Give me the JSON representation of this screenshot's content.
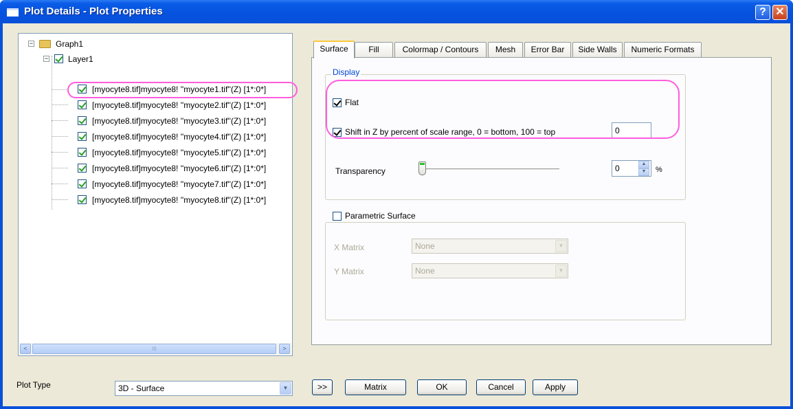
{
  "window": {
    "title": "Plot Details - Plot Properties",
    "help_glyph": "?",
    "close_glyph": "✕"
  },
  "tree": {
    "root_label": "Graph1",
    "layer_label": "Layer1",
    "items": [
      "[myocyte8.tif]myocyte8! ''myocyte1.tif''(Z) [1*:0*]",
      "[myocyte8.tif]myocyte8! ''myocyte2.tif''(Z) [1*:0*]",
      "[myocyte8.tif]myocyte8! ''myocyte3.tif''(Z) [1*:0*]",
      "[myocyte8.tif]myocyte8! ''myocyte4.tif''(Z) [1*:0*]",
      "[myocyte8.tif]myocyte8! ''myocyte5.tif''(Z) [1*:0*]",
      "[myocyte8.tif]myocyte8! ''myocyte6.tif''(Z) [1*:0*]",
      "[myocyte8.tif]myocyte8! ''myocyte7.tif''(Z) [1*:0*]",
      "[myocyte8.tif]myocyte8! ''myocyte8.tif''(Z) [1*:0*]"
    ],
    "scroll_left": "<",
    "scroll_right": ">",
    "scroll_grip": "III"
  },
  "tabs": [
    "Surface",
    "Fill",
    "Colormap / Contours",
    "Mesh",
    "Error Bar",
    "Side Walls",
    "Numeric Formats"
  ],
  "surface": {
    "display_group": "Display",
    "flat_label": "Flat",
    "flat_checked": true,
    "shift_label": "Shift in Z by percent of scale range, 0 = bottom, 100 = top",
    "shift_checked": true,
    "shift_value": "0",
    "transparency_label": "Transparency",
    "transparency_value": "0",
    "transparency_unit": "%",
    "parametric_label": "Parametric Surface",
    "parametric_checked": false,
    "x_matrix_label": "X Matrix",
    "x_matrix_value": "None",
    "y_matrix_label": "Y Matrix",
    "y_matrix_value": "None"
  },
  "footer": {
    "plot_type_label": "Plot Type",
    "plot_type_value": "3D - Surface",
    "expand_button": ">>",
    "matrix_button": "Matrix",
    "ok_button": "OK",
    "cancel_button": "Cancel",
    "apply_button": "Apply"
  },
  "colors": {
    "highlight": "#ff5cde",
    "titlebar": "#0a4fd8",
    "group_label": "#0046d5"
  }
}
